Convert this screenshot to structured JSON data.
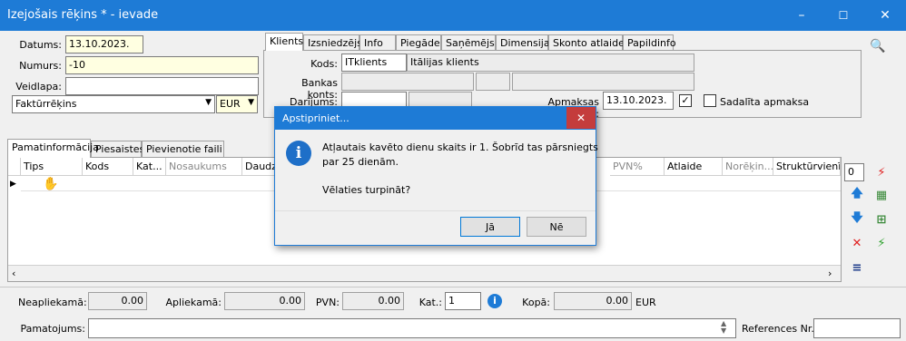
{
  "window": {
    "title": "Izejošais rēķins * - ievade",
    "minimize": "–",
    "maximize": "☐",
    "close": "✕"
  },
  "header": {
    "datums_label": "Datums:",
    "datums_value": "13.10.2023.",
    "numurs_label": "Numurs:",
    "numurs_value": "-10",
    "veidlapa_label": "Veidlapa:",
    "veidlapa_value": "",
    "form_type": "Faktūrrēķins",
    "currency": "EUR"
  },
  "top_tabs": [
    "Klients",
    "Izsniedzējs",
    "Info",
    "Piegāde",
    "Saņēmējs",
    "Dimensijas",
    "Skonto atlaides",
    "Papildinfo"
  ],
  "client": {
    "kods_label": "Kods:",
    "kods_value": "ITklients",
    "name_value": "Itālijas klients",
    "bank_label": "Bankas konts:",
    "darijums_label": "Darījums:",
    "apmaksas_label": "Apmaksas termiņš:",
    "apmaksas_value": "13.10.2023.",
    "sadalita_label": "Sadalīta apmaksa"
  },
  "bottom_tabs": [
    "Pamatinformācija",
    "Piesaistes",
    "Pievienotie faili"
  ],
  "grid": {
    "columns": [
      "Tips",
      "Kods",
      "Kat...",
      "Nosaukums",
      "Daudz",
      "PVN%",
      "Atlaide",
      "Norēķin...",
      "Struktūrvienība"
    ],
    "row_count_value": "0"
  },
  "totals": {
    "neapliekama_label": "Neapliekamā:",
    "neapliekama_value": "0.00",
    "apliekama_label": "Apliekamā:",
    "apliekama_value": "0.00",
    "pvn_label": "PVN:",
    "pvn_value": "0.00",
    "kat_label": "Kat.:",
    "kat_value": "1",
    "kopa_label": "Kopā:",
    "kopa_value": "0.00",
    "kopa_currency": "EUR"
  },
  "footer": {
    "pamatojums_label": "Pamatojums:",
    "pamatojums_value": "",
    "references_label": "References Nr.:",
    "references_value": ""
  },
  "dialog": {
    "title": "Apstipriniet...",
    "close": "✕",
    "message_line1": "Atļautais kavēto dienu skaits ir 1. Šobrīd tas pārsniegts",
    "message_line2": "par 25 dienām.",
    "question": "Vēlaties turpināt?",
    "yes_label": "Jā",
    "no_label": "Nē"
  }
}
